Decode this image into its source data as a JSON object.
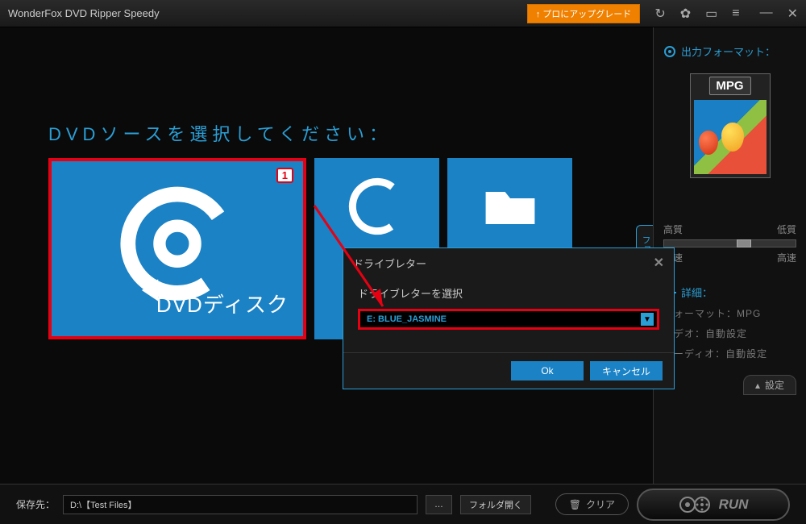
{
  "titlebar": {
    "title": "WonderFox DVD Ripper Speedy",
    "upgrade": "↑ プロにアップグレード"
  },
  "main": {
    "heading": "DVDソースを選択してください：",
    "tile_badge": "1",
    "tile_label": "DVDディスク",
    "file_tab": "ファイル"
  },
  "dialog": {
    "title": "ドライブレター",
    "body_label": "ドライブレターを選択",
    "selected_drive": "E:  BLUE_JASMINE",
    "ok": "Ok",
    "cancel": "キャンセル"
  },
  "sidebar": {
    "output_format_heading": "出力フォーマット：",
    "format_label": "MPG",
    "quality_high": "高質",
    "quality_low": "低質",
    "speed_low": "低速",
    "speed_high": "高速",
    "details_heading": "詳細：",
    "detail_format": "フォーマット：MPG",
    "detail_video": "ビデオ：自動設定",
    "detail_audio": "オーディオ：自動設定",
    "settings_btn": "設定"
  },
  "footer": {
    "save_label": "保存先：",
    "path": "D:\\【Test Files】",
    "open_folder": "フォルダ開く",
    "clear": "クリア",
    "run": "RUN"
  }
}
